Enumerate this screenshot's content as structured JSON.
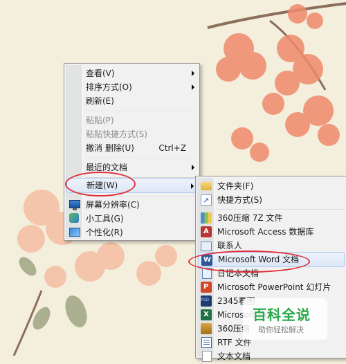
{
  "main_menu": {
    "items": [
      {
        "label": "查看(V)"
      },
      {
        "label": "排序方式(O)"
      },
      {
        "label": "刷新(E)"
      },
      {
        "label": "粘贴(P)"
      },
      {
        "label": "粘贴快捷方式(S)"
      },
      {
        "label": "撤消 删除(U)",
        "shortcut": "Ctrl+Z"
      },
      {
        "label": "最近的文档"
      },
      {
        "label": "新建(W)"
      },
      {
        "label": "屏幕分辨率(C)"
      },
      {
        "label": "小工具(G)"
      },
      {
        "label": "个性化(R)"
      }
    ]
  },
  "sub_menu": {
    "items": [
      {
        "label": "文件夹(F)",
        "icon": "folder-icon"
      },
      {
        "label": "快捷方式(S)",
        "icon": "shortcut-icon"
      },
      {
        "label": "360压缩 7Z 文件",
        "icon": "archive-icon"
      },
      {
        "label": "Microsoft Access 数据库",
        "icon": "access-icon"
      },
      {
        "label": "联系人",
        "icon": "contact-icon"
      },
      {
        "label": "Microsoft Word 文档",
        "icon": "word-icon"
      },
      {
        "label": "日记本文档",
        "icon": "notepad-icon"
      },
      {
        "label": "Microsoft PowerPoint 幻灯片",
        "icon": "ppt-icon"
      },
      {
        "label": "2345看图",
        "icon": "psd-icon"
      },
      {
        "label": "Microsoft Excel",
        "icon": "excel-icon"
      },
      {
        "label": "360压缩",
        "icon": "zip-icon"
      },
      {
        "label": "RTF 文件",
        "icon": "rtf-icon"
      },
      {
        "label": "文本文档",
        "icon": "txt-icon"
      }
    ]
  },
  "watermark": {
    "title": "百科全说",
    "subtitle": "助你轻松解决"
  },
  "colors": {
    "annotation": "#e0303a",
    "watermark_green": "#2aa84a"
  }
}
